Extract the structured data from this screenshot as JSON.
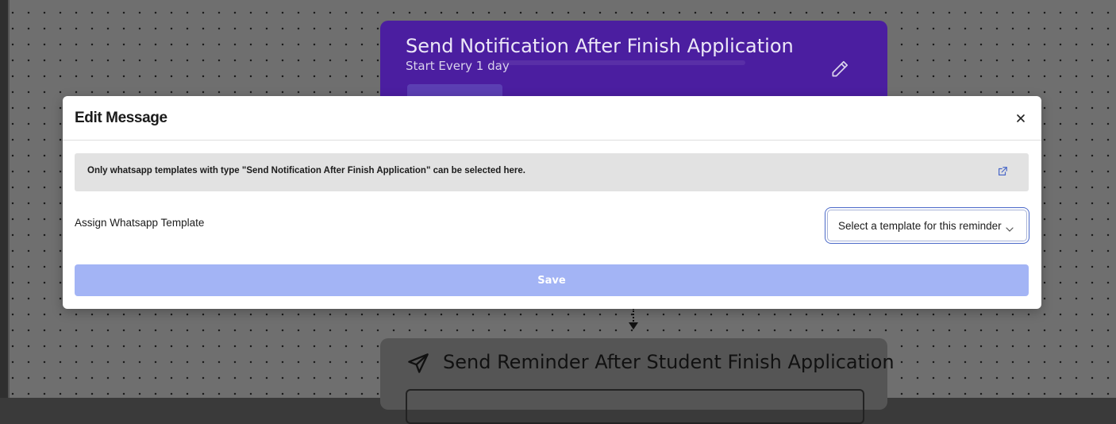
{
  "background": {
    "top_card": {
      "title": "Send Notification After Finish Application",
      "subtitle": "Start Every 1 day",
      "edit_icon": "pencil-icon"
    },
    "bottom_card": {
      "title": "Send Reminder After Student Finish Application",
      "icon": "send-icon"
    }
  },
  "modal": {
    "title": "Edit Message",
    "close_icon": "close-icon",
    "notice": {
      "text": "Only whatsapp templates with type \"Send Notification After Finish Application\" can be selected here.",
      "link_icon": "external-link-icon"
    },
    "field": {
      "label": "Assign Whatsapp Template",
      "selected_value": "Select a template for this reminder"
    },
    "save_label": "Save"
  },
  "colors": {
    "top_card_bg": "#4b1ea0",
    "save_button_bg": "#a3b4f5",
    "select_focus_ring": "#4a68c8",
    "notice_bg": "#e2e2e2"
  }
}
